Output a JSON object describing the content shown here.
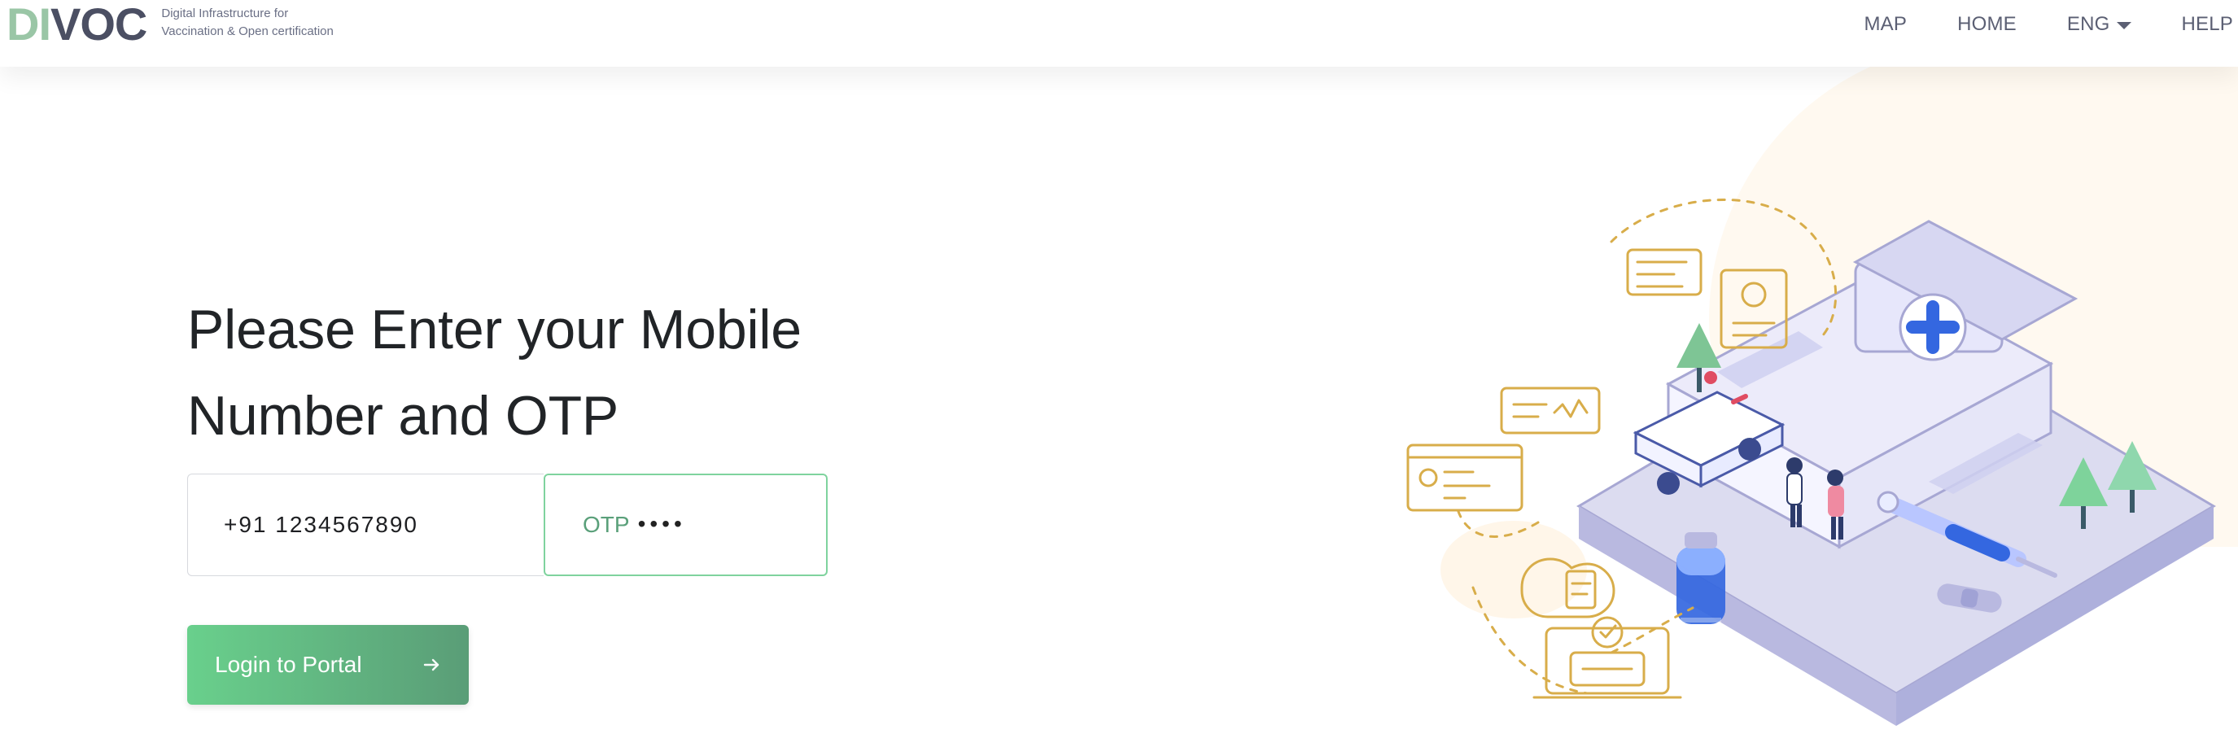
{
  "brand": {
    "logo_left": "DI",
    "logo_right": "VOC",
    "tagline_line1": "Digital Infrastructure for",
    "tagline_line2": "Vaccination & Open certification"
  },
  "nav": {
    "items": [
      {
        "label": "MAP"
      },
      {
        "label": "HOME"
      },
      {
        "label": "ENG"
      },
      {
        "label": "HELP"
      }
    ]
  },
  "page": {
    "title_line1": "Please Enter your Mobile",
    "title_line2": "Number and OTP"
  },
  "form": {
    "phone_value": "+91 1234567890",
    "otp_label": "OTP",
    "otp_masked": "••••",
    "login_label": "Login to Portal"
  },
  "icons": {
    "dropdown": "chevron-down-icon",
    "arrow": "arrow-right-icon"
  },
  "colors": {
    "accent": "#55c07a",
    "accent_dark": "#5aa07a"
  }
}
